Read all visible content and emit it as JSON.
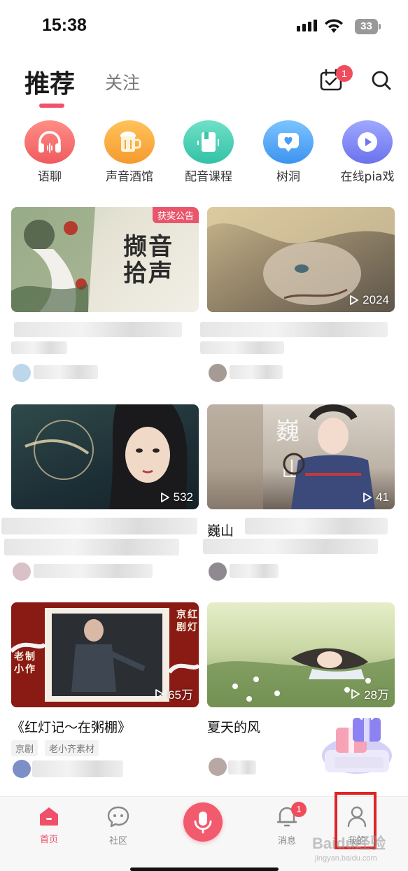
{
  "status_bar": {
    "time": "15:38",
    "battery": "33"
  },
  "header": {
    "tabs": [
      {
        "label": "推荐",
        "active": true
      },
      {
        "label": "关注",
        "active": false
      }
    ],
    "calendar_badge": "1"
  },
  "categories": [
    {
      "label": "语聊",
      "icon": "headphones-icon"
    },
    {
      "label": "声音酒馆",
      "icon": "beer-icon"
    },
    {
      "label": "配音课程",
      "icon": "book-icon"
    },
    {
      "label": "树洞",
      "icon": "heart-chat-icon"
    },
    {
      "label": "在线pia戏",
      "icon": "play-icon"
    }
  ],
  "cards": [
    {
      "badge": "获奖公告",
      "poster_text": "撷音拾声",
      "plays": "",
      "title": "",
      "tags": []
    },
    {
      "badge": "",
      "plays": "2024",
      "title": "",
      "tags": []
    },
    {
      "badge": "",
      "plays": "532",
      "title": "",
      "tags": []
    },
    {
      "badge": "",
      "plays": "41",
      "title": "巍山",
      "tags": []
    },
    {
      "badge": "",
      "plays": "65万",
      "title": "《红灯记～在粥棚》",
      "tags": [
        "京剧",
        "老小齐素材"
      ]
    },
    {
      "badge": "",
      "plays": "28万",
      "title": "夏天的风",
      "tags": []
    }
  ],
  "bottom_nav": [
    {
      "label": "首页",
      "active": true
    },
    {
      "label": "社区",
      "active": false
    },
    {
      "label": "",
      "active": false
    },
    {
      "label": "消息",
      "active": false,
      "badge": "1"
    },
    {
      "label": "我的",
      "active": false
    }
  ],
  "watermark": {
    "text": "Baidu经验",
    "url": "jingyan.baidu.com"
  },
  "colors": {
    "accent": "#f0506a",
    "badge": "#f04d5c"
  }
}
